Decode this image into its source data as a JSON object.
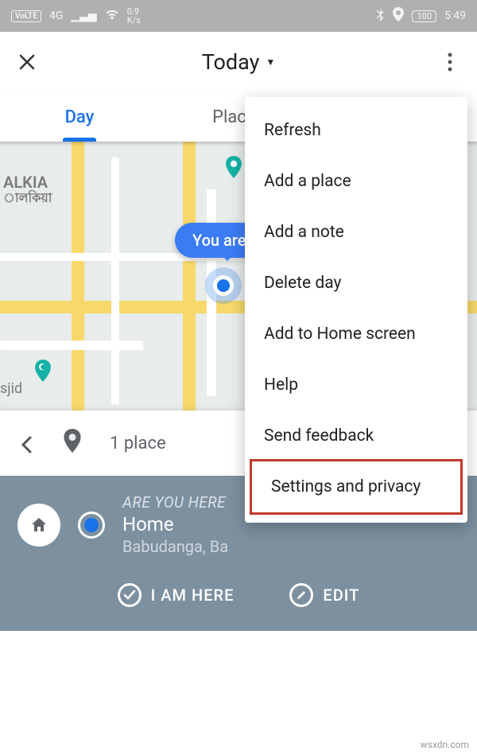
{
  "status": {
    "volte": "VoLTE",
    "net": "4G",
    "speed_top": "0.9",
    "speed_unit": "K/s",
    "battery": "100",
    "time": "5:49"
  },
  "header": {
    "title": "Today"
  },
  "tabs": {
    "day": "Day",
    "places": "Places"
  },
  "map": {
    "region_label": "ALKIA",
    "region_sub": "ালকিয়া",
    "you_badge": "You are",
    "sjid_label": "sjid"
  },
  "place_row": {
    "count_label": "1 place"
  },
  "bottom": {
    "question": "ARE YOU HERE",
    "name": "Home",
    "address": "Babudanga, Ba",
    "action_here": "I AM HERE",
    "action_edit": "EDIT"
  },
  "menu": {
    "items": [
      "Refresh",
      "Add a place",
      "Add a note",
      "Delete day",
      "Add to Home screen",
      "Help",
      "Send feedback",
      "Settings and privacy"
    ]
  },
  "watermark": "wsxdn.com"
}
